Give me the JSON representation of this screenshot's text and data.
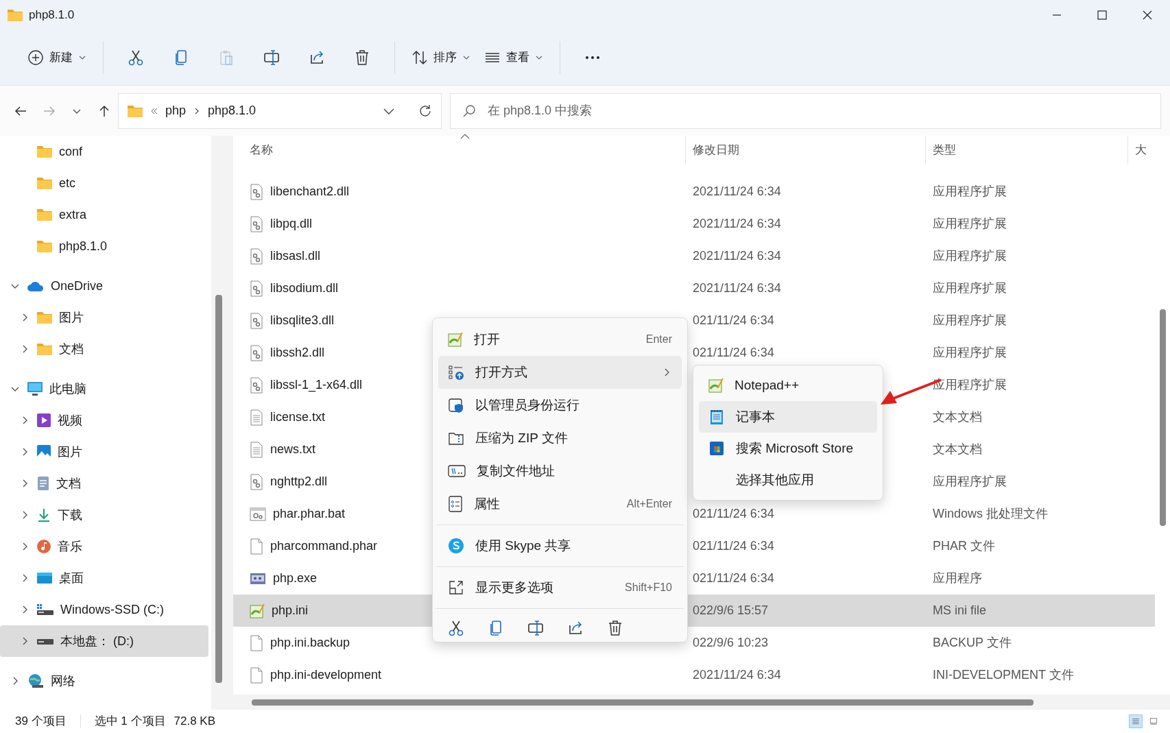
{
  "window": {
    "title": "php8.1.0"
  },
  "toolbar": {
    "new_label": "新建",
    "sort_label": "排序",
    "view_label": "查看",
    "paste_disabled": true
  },
  "navigation": {
    "forward_disabled": true
  },
  "address": {
    "crumbs": [
      "php",
      "php8.1.0"
    ]
  },
  "search": {
    "placeholder": "在 php8.1.0 中搜索"
  },
  "sidebar": {
    "folders": [
      {
        "label": "conf",
        "kind": "folder",
        "selected": false
      },
      {
        "label": "etc",
        "kind": "folder",
        "selected": false
      },
      {
        "label": "extra",
        "kind": "folder",
        "selected": false
      },
      {
        "label": "php8.1.0",
        "kind": "folder",
        "selected": false
      }
    ],
    "items": [
      {
        "label": "OneDrive",
        "kind": "cloud",
        "expanded": true,
        "selected": false,
        "children": [
          {
            "label": "图片",
            "kind": "folder",
            "expanded": false,
            "selected": false
          },
          {
            "label": "文档",
            "kind": "folder",
            "expanded": false,
            "selected": false
          }
        ]
      },
      {
        "label": "此电脑",
        "kind": "computer",
        "expanded": true,
        "selected": false,
        "children": [
          {
            "label": "视频",
            "kind": "videos",
            "expanded": false,
            "selected": false
          },
          {
            "label": "图片",
            "kind": "pictures",
            "expanded": false,
            "selected": false
          },
          {
            "label": "文档",
            "kind": "documents",
            "expanded": false,
            "selected": false
          },
          {
            "label": "下载",
            "kind": "downloads",
            "expanded": false,
            "selected": false
          },
          {
            "label": "音乐",
            "kind": "music",
            "expanded": false,
            "selected": false
          },
          {
            "label": "桌面",
            "kind": "desktop",
            "expanded": false,
            "selected": false
          },
          {
            "label": "Windows-SSD (C:)",
            "kind": "system-drive",
            "expanded": false,
            "selected": false
          },
          {
            "label": "本地盘： (D:)",
            "kind": "drive",
            "expanded": false,
            "selected": true
          }
        ]
      },
      {
        "label": "网络",
        "kind": "network",
        "expanded": false,
        "selected": false
      }
    ]
  },
  "file_list": {
    "columns": [
      "名称",
      "修改日期",
      "类型",
      "大"
    ],
    "rows": [
      {
        "name": "libenchant2.dll",
        "date": "2021/11/24 6:34",
        "type": "应用程序扩展",
        "kind": "dll",
        "selected": false
      },
      {
        "name": "libpq.dll",
        "date": "2021/11/24 6:34",
        "type": "应用程序扩展",
        "kind": "dll",
        "selected": false
      },
      {
        "name": "libsasl.dll",
        "date": "2021/11/24 6:34",
        "type": "应用程序扩展",
        "kind": "dll",
        "selected": false
      },
      {
        "name": "libsodium.dll",
        "date": "2021/11/24 6:34",
        "type": "应用程序扩展",
        "kind": "dll",
        "selected": false
      },
      {
        "name": "libsqlite3.dll",
        "date": "021/11/24 6:34",
        "type": "应用程序扩展",
        "kind": "dll",
        "selected": false
      },
      {
        "name": "libssh2.dll",
        "date": "021/11/24 6:34",
        "type": "应用程序扩展",
        "kind": "dll",
        "selected": false
      },
      {
        "name": "libssl-1_1-x64.dll",
        "type": "应用程序扩展",
        "kind": "dll",
        "selected": false
      },
      {
        "name": "license.txt",
        "type": "文本文档",
        "kind": "text",
        "selected": false
      },
      {
        "name": "news.txt",
        "type": "文本文档",
        "kind": "text",
        "selected": false
      },
      {
        "name": "nghttp2.dll",
        "type": "应用程序扩展",
        "kind": "dll",
        "selected": false
      },
      {
        "name": "phar.phar.bat",
        "date": "021/11/24 6:34",
        "type": "Windows 批处理文件",
        "kind": "batch",
        "selected": false
      },
      {
        "name": "pharcommand.phar",
        "date": "021/11/24 6:34",
        "type": "PHAR 文件",
        "kind": "blank",
        "selected": false
      },
      {
        "name": "php.exe",
        "date": "021/11/24 6:34",
        "type": "应用程序",
        "kind": "exe",
        "selected": false
      },
      {
        "name": "php.ini",
        "date": "022/9/6 15:57",
        "type": "MS ini file",
        "kind": "ini",
        "selected": true
      },
      {
        "name": "php.ini.backup",
        "date": "022/9/6 10:23",
        "type": "BACKUP 文件",
        "kind": "blank",
        "selected": false
      },
      {
        "name": "php.ini-development",
        "date": "2021/11/24 6:34",
        "type": "INI-DEVELOPMENT 文件",
        "kind": "blank",
        "selected": false
      }
    ]
  },
  "context_menu": {
    "items": [
      {
        "kind": "item",
        "label": "打开",
        "shortcut": "Enter",
        "has_submenu": false,
        "selected": false
      },
      {
        "kind": "item",
        "label": "打开方式",
        "has_submenu": true,
        "selected": true
      },
      {
        "kind": "item",
        "label": "以管理员身份运行",
        "has_submenu": false,
        "selected": false
      },
      {
        "kind": "item",
        "label": "压缩为 ZIP 文件",
        "has_submenu": false,
        "selected": false
      },
      {
        "kind": "item",
        "label": "复制文件地址",
        "has_submenu": false,
        "selected": false
      },
      {
        "kind": "item",
        "label": "属性",
        "shortcut": "Alt+Enter",
        "has_submenu": false,
        "selected": false
      },
      {
        "kind": "separator"
      },
      {
        "kind": "item",
        "label": "使用 Skype 共享",
        "has_submenu": false,
        "selected": false
      },
      {
        "kind": "separator"
      },
      {
        "kind": "item",
        "label": "显示更多选项",
        "shortcut": "Shift+F10",
        "has_submenu": false,
        "selected": false
      },
      {
        "kind": "separator"
      }
    ]
  },
  "submenu": {
    "items": [
      {
        "label": "Notepad++",
        "selected": false
      },
      {
        "label": "记事本",
        "selected": true
      },
      {
        "label": "搜索 Microsoft Store",
        "selected": false
      },
      {
        "label": "选择其他应用",
        "selected": false
      }
    ]
  },
  "status_bar": {
    "item_count": "39 个项目",
    "selection": "选中 1 个项目",
    "size": "72.8 KB",
    "views": [
      {
        "selected": true
      },
      {
        "selected": false
      }
    ]
  }
}
